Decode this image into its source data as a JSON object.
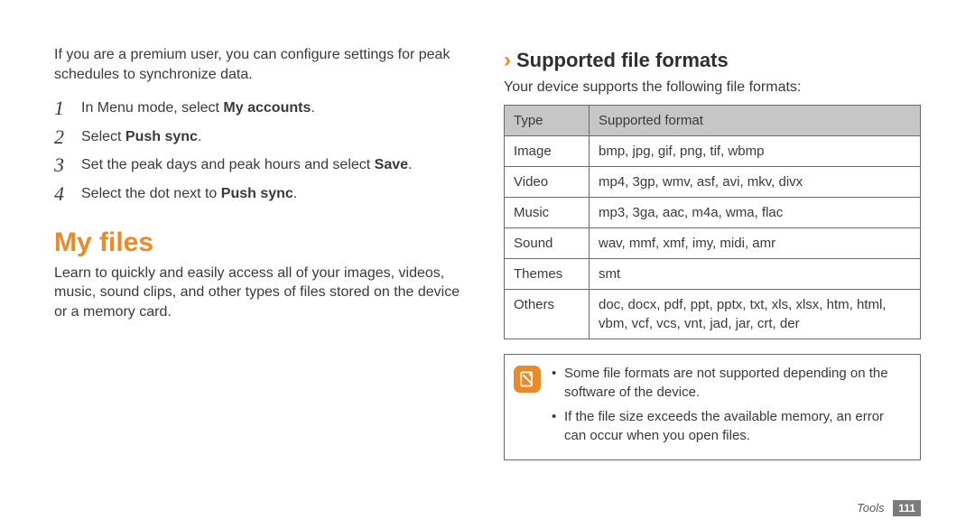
{
  "left": {
    "intro": "If you are a premium user, you can configure settings for peak schedules to synchronize data.",
    "steps": [
      {
        "num": "1",
        "pre": "In Menu mode, select ",
        "bold": "My accounts",
        "post": "."
      },
      {
        "num": "2",
        "pre": "Select ",
        "bold": "Push sync",
        "post": "."
      },
      {
        "num": "3",
        "pre": "Set the peak days and peak hours and select ",
        "bold": "Save",
        "post": "."
      },
      {
        "num": "4",
        "pre": "Select the dot next to ",
        "bold": "Push sync",
        "post": "."
      }
    ],
    "myfiles_heading": "My files",
    "myfiles_desc": "Learn to quickly and easily access all of your images, videos, music, sound clips, and other types of files stored on the device or a memory card."
  },
  "right": {
    "chevron": "›",
    "heading": "Supported file formats",
    "intro": "Your device supports the following file formats:",
    "table": {
      "head": [
        "Type",
        "Supported format"
      ],
      "rows": [
        [
          "Image",
          "bmp, jpg, gif, png, tif, wbmp"
        ],
        [
          "Video",
          "mp4, 3gp, wmv, asf, avi, mkv, divx"
        ],
        [
          "Music",
          "mp3, 3ga, aac, m4a, wma, flac"
        ],
        [
          "Sound",
          "wav, mmf, xmf, imy, midi, amr"
        ],
        [
          "Themes",
          "smt"
        ],
        [
          "Others",
          "doc, docx, pdf, ppt, pptx, txt, xls, xlsx, htm, html, vbm, vcf, vcs, vnt, jad, jar, crt, der"
        ]
      ]
    },
    "notes": [
      "Some file formats are not supported depending on the software of the device.",
      "If the file size exceeds the available memory, an error can occur when you open files."
    ]
  },
  "footer": {
    "section": "Tools",
    "page": "111"
  }
}
